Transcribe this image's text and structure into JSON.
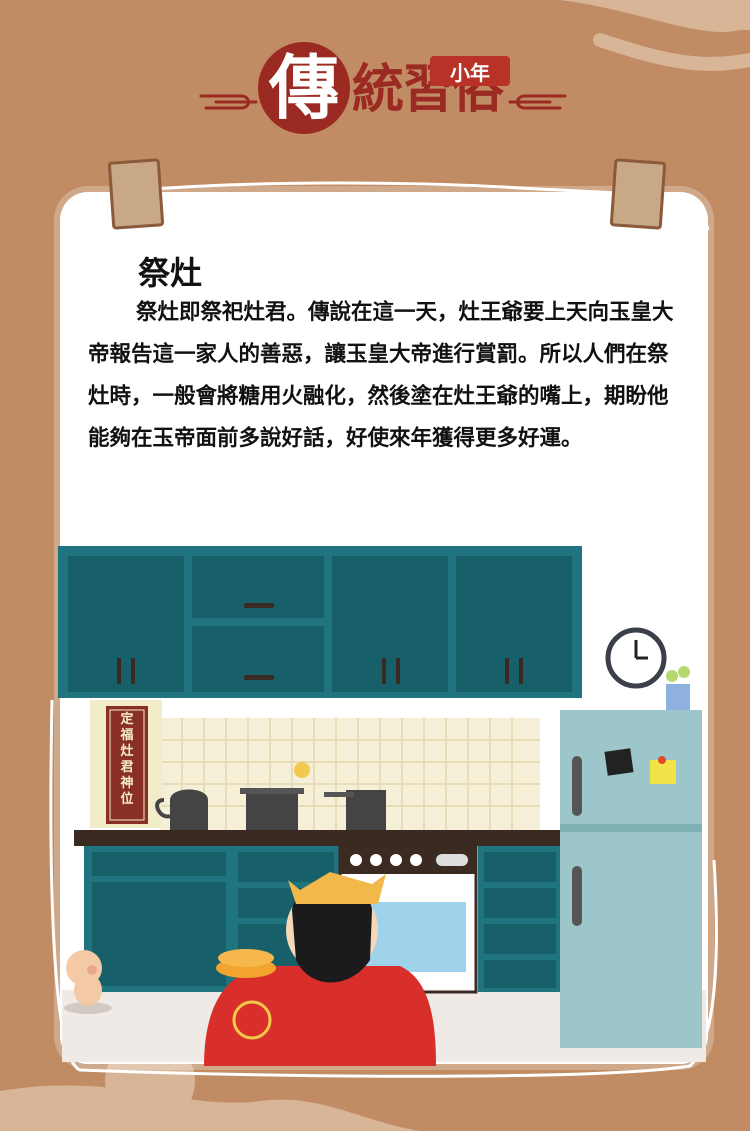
{
  "header": {
    "badge_char": "傳",
    "title_rest": "統習俗",
    "tag": "小年"
  },
  "card": {
    "heading": "祭灶",
    "body": "祭灶即祭祀灶君。傳說在這一天，灶王爺要上天向玉皇大帝報告這一家人的善惡，讓玉皇大帝進行賞罰。所以人們在祭灶時，一般會將糖用火融化，然後塗在灶王爺的嘴上，期盼他能夠在玉帝面前多說好話，好使來年獲得更多好運。"
  },
  "illustration": {
    "plaque_text": "定福灶君神位"
  },
  "colors": {
    "background": "#c18b63",
    "accent": "#9b2a22",
    "cabinet": "#1f7480",
    "fridge": "#9cc6c9"
  }
}
